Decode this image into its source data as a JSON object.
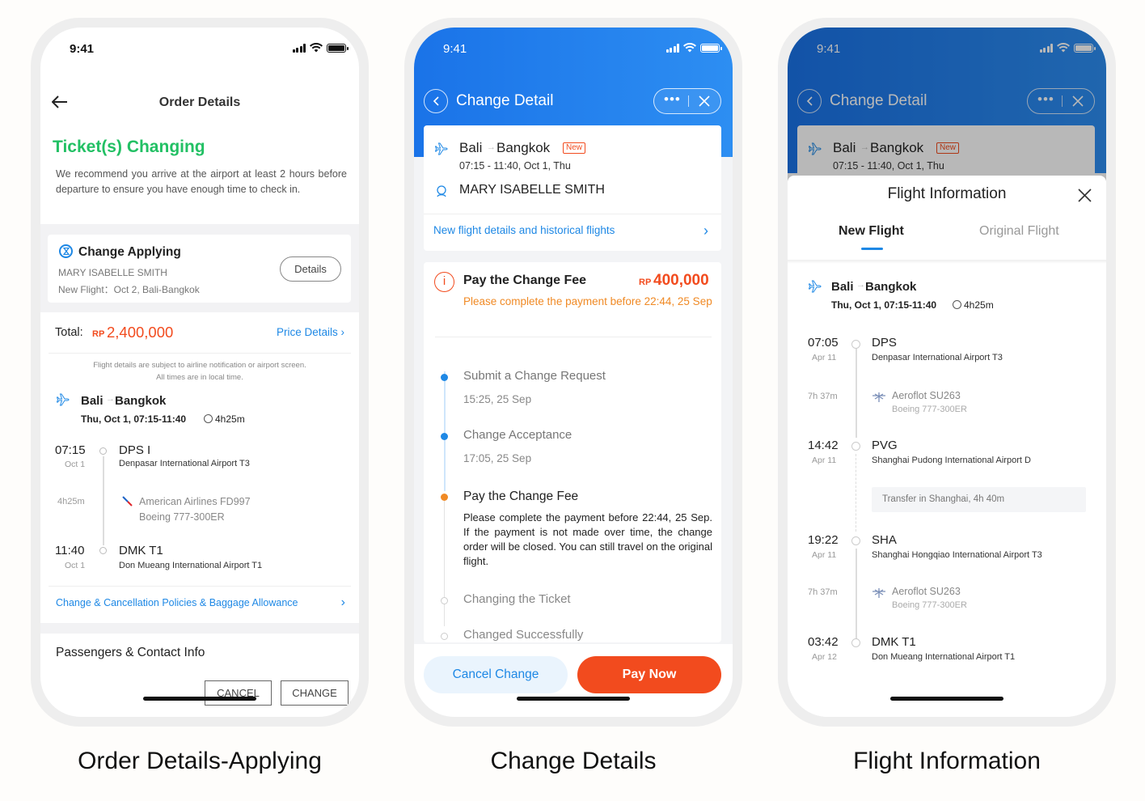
{
  "status": {
    "time": "9:41"
  },
  "captions": [
    "Order Details-Applying",
    "Change Details",
    "Flight Information"
  ],
  "colors": {
    "accent_blue": "#1e88e5",
    "accent_green": "#22c064",
    "accent_orange": "#f08a25",
    "accent_red": "#f24b1e"
  },
  "screen1": {
    "nav_title": "Order Details",
    "status_title": "Ticket(s) Changing",
    "status_desc": "We recommend you arrive at the airport at least 2 hours before departure to ensure you have enough time to check in.",
    "applying": {
      "title": "Change Applying",
      "name": "MARY ISABELLE SMITH",
      "new_flight": "New Flight：Oct 2, Bali-Bangkok",
      "details_btn": "Details"
    },
    "total_label": "Total:",
    "currency": "RP",
    "total": "2,400,000",
    "price_details": "Price Details",
    "notice1": "Flight details are subject to airline notification or airport screen.",
    "notice2": "All times are in local time.",
    "route_from": "Bali",
    "route_to": "Bangkok",
    "route_date": "Thu, Oct 1, 07:15-11:40",
    "duration": "4h25m",
    "dep_time": "07:15",
    "dep_date": "Oct 1",
    "dep_code": "DPS I",
    "dep_airport": "Denpasar International Airport T3",
    "leg_duration": "4h25m",
    "airline": "American Airlines FD997",
    "aircraft": "Boeing 777-300ER",
    "arr_time": "11:40",
    "arr_date": "Oct 1",
    "arr_code": "DMK T1",
    "arr_airport": "Don Mueang International Airport T1",
    "policies": "Change & Cancellation Policies & Baggage Allowance",
    "passengers_title": "Passengers & Contact Info",
    "cancel_btn": "CANCEL",
    "change_btn": "CHANGE"
  },
  "screen2": {
    "nav_title": "Change Detail",
    "route_from": "Bali",
    "route_to": "Bangkok",
    "badge": "New",
    "flight_time": "07:15 - 11:40, Oct 1, Thu",
    "passenger": "MARY ISABELLE SMITH",
    "history_link": "New flight details and historical flights",
    "fee_title": "Pay the Change Fee",
    "fee_currency": "RP",
    "fee_amount": "400,000",
    "fee_deadline": "Please complete the payment before 22:44, 25 Sep",
    "steps": [
      {
        "title": "Submit a Change Request",
        "time": "15:25, 25 Sep",
        "state": "done"
      },
      {
        "title": "Change Acceptance",
        "time": "17:05, 25 Sep",
        "state": "done"
      },
      {
        "title": "Pay the Change Fee",
        "desc": "Please complete the payment before 22:44, 25 Sep. If the payment is not made over time, the change order will be closed. You can still travel on the original flight.",
        "state": "current"
      },
      {
        "title": "Changing the Ticket",
        "state": "pending"
      },
      {
        "title": "Changed Successfully",
        "state": "pending"
      }
    ],
    "cancel_btn": "Cancel Change",
    "pay_btn": "Pay Now"
  },
  "screen3": {
    "nav_title": "Change Detail",
    "bg_route_from": "Bali",
    "bg_route_to": "Bangkok",
    "bg_badge": "New",
    "bg_flight_time": "07:15 - 11:40, Oct 1, Thu",
    "sheet_title": "Flight Information",
    "tabs": [
      "New Flight",
      "Original Flight"
    ],
    "route_from": "Bali",
    "route_to": "Bangkok",
    "route_date": "Thu, Oct 1, 07:15-11:40",
    "duration": "4h25m",
    "stops": [
      {
        "time": "07:05",
        "date": "Apr 11",
        "code": "DPS",
        "airport": "Denpasar International Airport T3"
      },
      {
        "time": "14:42",
        "date": "Apr 11",
        "code": "PVG",
        "airport": "Shanghai Pudong International Airport D"
      },
      {
        "time": "19:22",
        "date": "Apr 11",
        "code": "SHA",
        "airport": "Shanghai Hongqiao International Airport T3"
      },
      {
        "time": "03:42",
        "date": "Apr 12",
        "code": "DMK T1",
        "airport": "Don Mueang International Airport T1"
      }
    ],
    "legs": [
      {
        "duration": "7h 37m",
        "airline": "Aeroflot SU263",
        "aircraft": "Boeing 777-300ER"
      },
      {
        "duration": "7h 37m",
        "airline": "Aeroflot SU263",
        "aircraft": "Boeing 777-300ER"
      }
    ],
    "transfer": "Transfer in Shanghai, 4h 40m"
  }
}
